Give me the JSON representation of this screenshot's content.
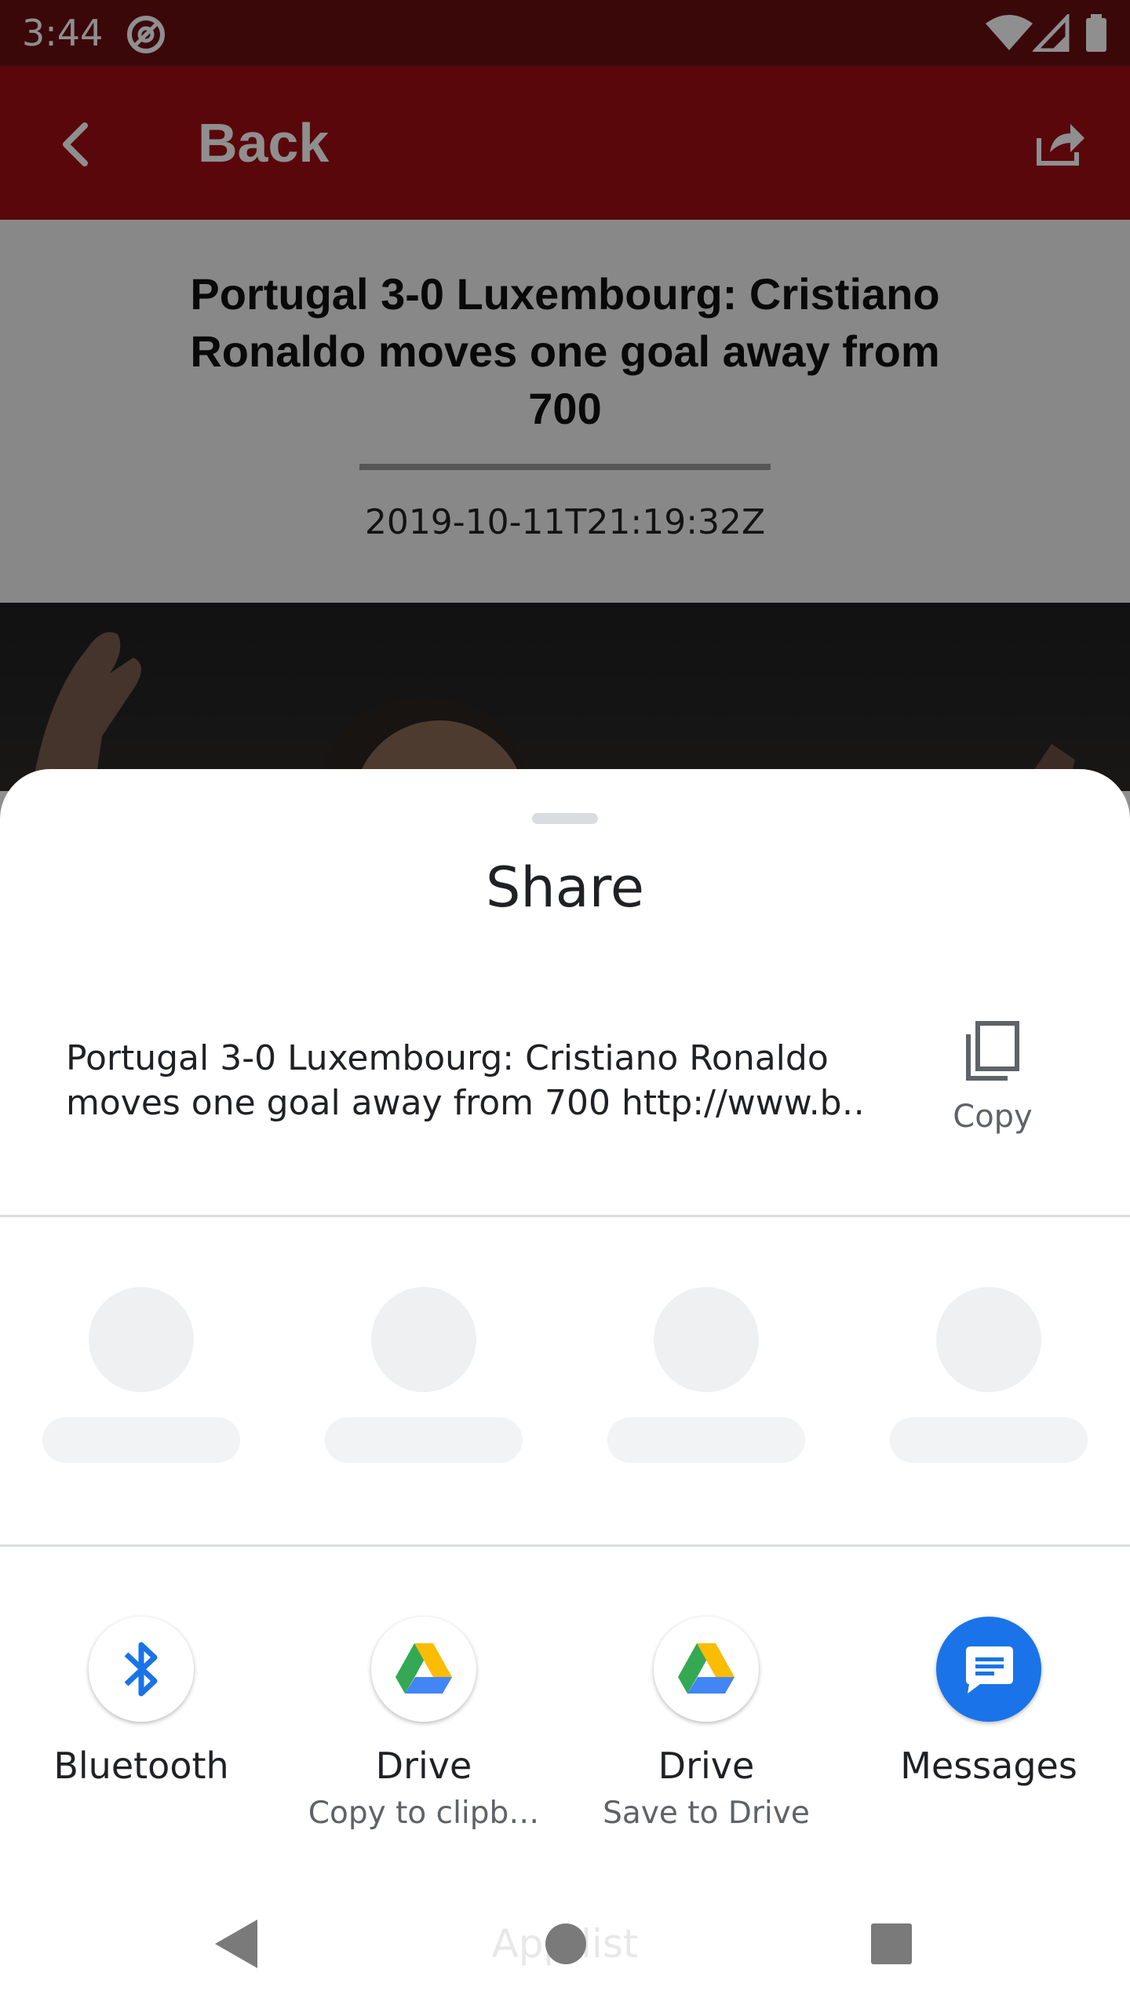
{
  "status_bar": {
    "time": "3:44",
    "icons": [
      "at-sign-icon",
      "wifi-icon",
      "signal-icon",
      "battery-icon"
    ]
  },
  "app_bar": {
    "back_label": "Back",
    "icons": [
      "back-arrow-icon",
      "share-icon"
    ],
    "color": "#a10d14"
  },
  "article": {
    "title": "Portugal 3-0 Luxembourg: Cristiano Ronaldo moves one goal away from 700",
    "date": "2019-10-11T21:19:32Z"
  },
  "share_sheet": {
    "title": "Share",
    "preview_line1": "Portugal 3-0 Luxembourg: Cristiano Ronaldo",
    "preview_line2": "moves one goal away from 700 http://www.b…",
    "copy_label": "Copy",
    "targets": [
      {
        "label": "Bluetooth",
        "sublabel": "",
        "icon": "bluetooth-icon"
      },
      {
        "label": "Drive",
        "sublabel": "Copy to clipb…",
        "icon": "drive-icon"
      },
      {
        "label": "Drive",
        "sublabel": "Save to Drive",
        "icon": "drive-icon"
      },
      {
        "label": "Messages",
        "sublabel": "",
        "icon": "messages-icon",
        "color": "#1a73e8"
      }
    ]
  },
  "nav_bar": {
    "hint": "App list",
    "icons": [
      "back-triangle-icon",
      "home-circle-icon",
      "recents-square-icon"
    ]
  }
}
